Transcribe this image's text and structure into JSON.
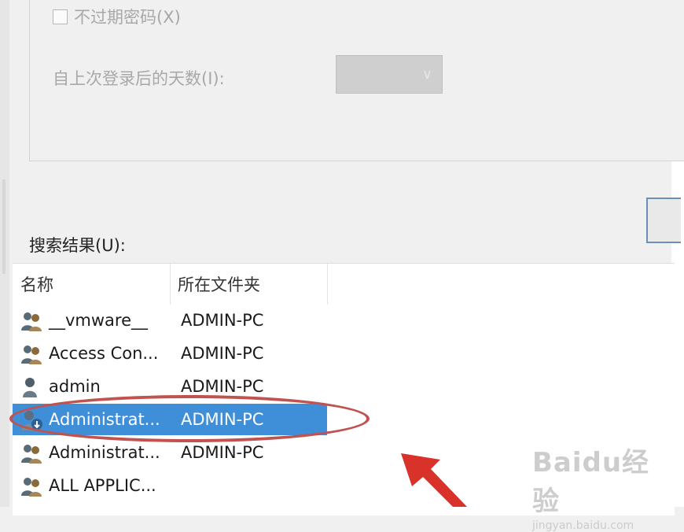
{
  "filters": {
    "non_expiring_password_label": "不过期密码(X)",
    "days_since_last_logon_label": "自上次登录后的天数(I):"
  },
  "search_results": {
    "label": "搜索结果(U):",
    "columns": [
      "名称",
      "所在文件夹"
    ],
    "rows": [
      {
        "name": "__vmware__",
        "folder": "ADMIN-PC",
        "icon": "group-icon",
        "selected": false
      },
      {
        "name": "Access Con...",
        "folder": "ADMIN-PC",
        "icon": "group-icon",
        "selected": false
      },
      {
        "name": "admin",
        "folder": "ADMIN-PC",
        "icon": "user-icon",
        "selected": false
      },
      {
        "name": "Administrat...",
        "folder": "ADMIN-PC",
        "icon": "user-disabled-icon",
        "selected": true
      },
      {
        "name": "Administrat...",
        "folder": "ADMIN-PC",
        "icon": "group-icon",
        "selected": false
      },
      {
        "name": "ALL APPLIC...",
        "folder": "",
        "icon": "group-icon",
        "selected": false
      }
    ]
  },
  "annotations": {
    "highlight_color": "#c0524f",
    "arrow_color": "#d9322b"
  },
  "watermark": {
    "brand": "Baidu经验",
    "url": "jingyan.baidu.com"
  },
  "colors": {
    "selection": "#3f8fd8"
  }
}
